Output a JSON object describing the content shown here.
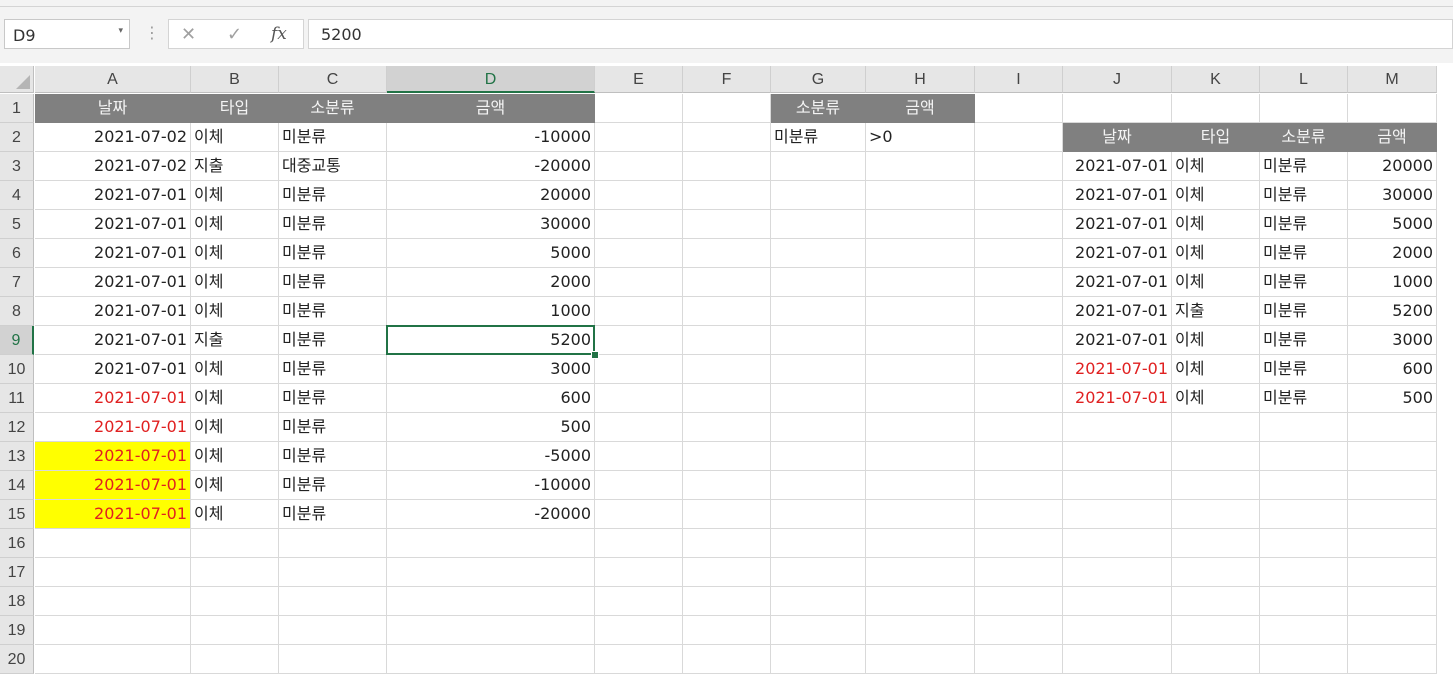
{
  "formula_bar": {
    "name_box": "D9",
    "name_box_arrow": "▾",
    "separator": "⋮",
    "cancel_icon": "✕",
    "enter_icon": "✓",
    "fx_label": "fx",
    "formula": "5200"
  },
  "sheet": {
    "columns": [
      "A",
      "B",
      "C",
      "D",
      "E",
      "F",
      "G",
      "H",
      "I",
      "J",
      "K",
      "L",
      "M"
    ],
    "rows": [
      "1",
      "2",
      "3",
      "4",
      "5",
      "6",
      "7",
      "8",
      "9",
      "10",
      "11",
      "12",
      "13",
      "14",
      "15",
      "16",
      "17",
      "18",
      "19",
      "20"
    ],
    "selected_column": "D",
    "selected_row": "9",
    "header_fill": "#808080",
    "highlight_fill": "#ffff00",
    "red_text": "#e02020",
    "accent": "#217346"
  },
  "table_main": {
    "headers": [
      "날짜",
      "타입",
      "소분류",
      "금액"
    ],
    "rows": [
      [
        "2021-07-02",
        "이체",
        "미분류",
        "-10000"
      ],
      [
        "2021-07-02",
        "지출",
        "대중교통",
        "-20000"
      ],
      [
        "2021-07-01",
        "이체",
        "미분류",
        "20000"
      ],
      [
        "2021-07-01",
        "이체",
        "미분류",
        "30000"
      ],
      [
        "2021-07-01",
        "이체",
        "미분류",
        "5000"
      ],
      [
        "2021-07-01",
        "이체",
        "미분류",
        "2000"
      ],
      [
        "2021-07-01",
        "이체",
        "미분류",
        "1000"
      ],
      [
        "2021-07-01",
        "지출",
        "미분류",
        "5200"
      ],
      [
        "2021-07-01",
        "이체",
        "미분류",
        "3000"
      ],
      [
        "2021-07-01",
        "이체",
        "미분류",
        "600"
      ],
      [
        "2021-07-01",
        "이체",
        "미분류",
        "500"
      ],
      [
        "2021-07-01",
        "이체",
        "미분류",
        "-5000"
      ],
      [
        "2021-07-01",
        "이체",
        "미분류",
        "-10000"
      ],
      [
        "2021-07-01",
        "이체",
        "미분류",
        "-20000"
      ]
    ]
  },
  "criteria": {
    "headers": [
      "소분류",
      "금액"
    ],
    "values": [
      "미분류",
      ">0"
    ]
  },
  "table_result": {
    "headers": [
      "날짜",
      "타입",
      "소분류",
      "금액"
    ],
    "rows": [
      [
        "2021-07-01",
        "이체",
        "미분류",
        "20000"
      ],
      [
        "2021-07-01",
        "이체",
        "미분류",
        "30000"
      ],
      [
        "2021-07-01",
        "이체",
        "미분류",
        "5000"
      ],
      [
        "2021-07-01",
        "이체",
        "미분류",
        "2000"
      ],
      [
        "2021-07-01",
        "이체",
        "미분류",
        "1000"
      ],
      [
        "2021-07-01",
        "지출",
        "미분류",
        "5200"
      ],
      [
        "2021-07-01",
        "이체",
        "미분류",
        "3000"
      ],
      [
        "2021-07-01",
        "이체",
        "미분류",
        "600"
      ],
      [
        "2021-07-01",
        "이체",
        "미분류",
        "500"
      ]
    ]
  }
}
